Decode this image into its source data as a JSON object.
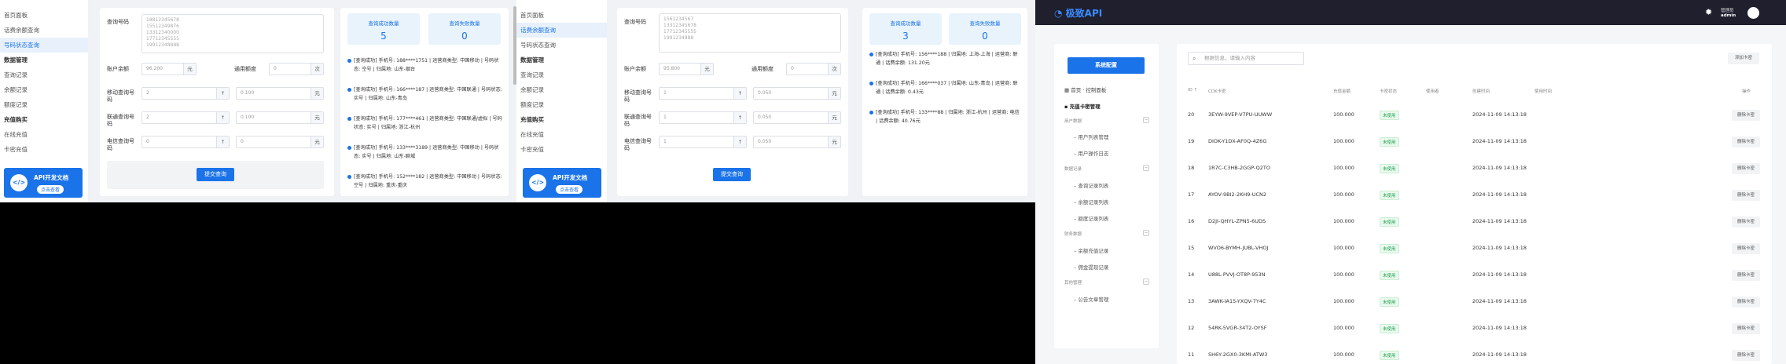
{
  "sidebar_a": {
    "items": [
      "首页面板",
      "话费余额查询",
      "号码状态查询"
    ],
    "sections": [
      {
        "title": "数据管理",
        "items": [
          "查询记录",
          "余额记录",
          "额度记录"
        ]
      },
      {
        "title": "充值购买",
        "items": [
          "在线充值",
          "卡密充值"
        ]
      }
    ]
  },
  "api_card": {
    "title": "API开发文档",
    "button": "点击查看",
    "icon": "</>"
  },
  "form": {
    "query_label": "查询号码",
    "query_text_a": "18812345678\n15512349876\n13312340000\n17712345555\n19912348888",
    "query_text_b": "1561234567\n13312345678\n17712345555\n1991234888",
    "balance_label": "账户余额",
    "balance_value": "96.200",
    "balance_unit": "元",
    "balance_value_b": "95.800",
    "limit_label": "通用额度",
    "limit_value": "0",
    "limit_unit": "次",
    "mobile_label": "移动查询号码",
    "mobile_count": "2",
    "mobile_price": "0.100",
    "mobile_count_b": "1",
    "mobile_price_b": "0.050",
    "unicom_label": "联通查询号码",
    "unicom_count": "2",
    "unicom_price": "0.100",
    "unicom_count_b": "1",
    "unicom_price_b": "0.050",
    "telecom_label": "电信查询号码",
    "telecom_count": "0",
    "telecom_price": "0",
    "telecom_count_b": "1",
    "telecom_price_b": "0.050",
    "stepper": "↑",
    "submit": "提交查询"
  },
  "results_a": {
    "success_label": "查询成功数量",
    "success_value": "5",
    "fail_label": "查询失败数量",
    "fail_value": "0",
    "logs": [
      "[查询成功] 手机号: 188****1751 | 运营商类型: 中国移动 | 号码状态: 空号 | 归属地: 山东-烟台",
      "[查询成功] 手机号: 166****187 | 运营商类型: 中国联通 | 号码状态: 实号 | 归属地: 山东-青岛",
      "[查询成功] 手机号: 177****461 | 运营商类型: 中国联通/虚拟 | 号码状态: 实号 | 归属地: 浙江-杭州",
      "[查询成功] 手机号: 133****3189 | 运营商类型: 中国移动 | 号码状态: 实号 | 归属地: 山东-聊城",
      "[查询成功] 手机号: 152****182 | 运营商类型: 中国移动 | 号码状态: 空号 | 归属地: 重庆-重庆"
    ]
  },
  "sidebar_b": {
    "items": [
      "首页面板",
      "话费余额查询",
      "号码状态查询"
    ],
    "sections": [
      {
        "title": "数据管理",
        "items": [
          "查询记录",
          "余额记录",
          "额度记录"
        ]
      },
      {
        "title": "充值购买",
        "items": [
          "在线充值",
          "卡密充值"
        ]
      }
    ]
  },
  "results_b": {
    "success_label": "查询成功数量",
    "success_value": "3",
    "fail_label": "查询失败数量",
    "fail_value": "0",
    "logs": [
      "[查询成功] 手机号: 156****188 | 归属地: 上海-上海 | 运营商: 联通 | 话费余额: 131.20元",
      "[查询成功] 手机号: 166****037 | 归属地: 山东-青岛 | 运营商: 联通 | 话费余额: 0.43元",
      "[查询成功] 手机号: 133****88 | 归属地: 浙江-杭州 | 运营商: 电信 | 话费余额: 40.76元"
    ]
  },
  "admin": {
    "logo": "极致API",
    "user_label": "管理员",
    "user_name": "admin",
    "sys_button": "系统配置",
    "menu_top": [
      "首页 · 控制面板",
      "充值卡密管理"
    ],
    "menu_sections": [
      {
        "title": "用户数据",
        "items": [
          "用户列表管理",
          "用户操作日志"
        ]
      },
      {
        "title": "数据记录",
        "items": [
          "查询记录列表",
          "余额记录列表",
          "额度记录列表"
        ]
      },
      {
        "title": "财务数据",
        "items": [
          "余额充值记录",
          "佣金提现记录"
        ]
      },
      {
        "title": "其他管理",
        "items": [
          "公告文章管理"
        ]
      }
    ],
    "search_placeholder": "根据信息，请输入内容",
    "add_button": "添加卡密",
    "columns": [
      "ID ↑",
      "CDK卡密",
      "充值金额",
      "卡密状态",
      "使用者",
      "创建时间",
      "使用时间",
      "操作"
    ],
    "status_tag": "未使用",
    "delete_label": "删除卡密",
    "rows": [
      {
        "id": "20",
        "cdk": "3EYW-9VEP-V7PU-UUWW",
        "amount": "100.000",
        "created": "2024-11-09 14:13:18"
      },
      {
        "id": "19",
        "cdk": "DIOK-Y1DX-AF0Q-4Z6G",
        "amount": "100.000",
        "created": "2024-11-09 14:13:18"
      },
      {
        "id": "18",
        "cdk": "1R7C-C3HB-2GGP-Q2TO",
        "amount": "100.000",
        "created": "2024-11-09 14:13:18"
      },
      {
        "id": "17",
        "cdk": "AYOV-9BI2-2KH9-UCN2",
        "amount": "100.000",
        "created": "2024-11-09 14:13:18"
      },
      {
        "id": "16",
        "cdk": "D2JI-QHYL-ZPN5-6UDS",
        "amount": "100.000",
        "created": "2024-11-09 14:13:18"
      },
      {
        "id": "15",
        "cdk": "WVO6-BYMH-JUBL-VHOJ",
        "amount": "100.000",
        "created": "2024-11-09 14:13:18"
      },
      {
        "id": "14",
        "cdk": "U88L-PVVJ-OT8P-953N",
        "amount": "100.000",
        "created": "2024-11-09 14:13:18"
      },
      {
        "id": "13",
        "cdk": "3AWK-IA15-YXQV-7Y4C",
        "amount": "100.000",
        "created": "2024-11-09 14:13:18"
      },
      {
        "id": "12",
        "cdk": "54RK-5VGR-34T2-OYSF",
        "amount": "100.000",
        "created": "2024-11-09 14:13:18"
      },
      {
        "id": "11",
        "cdk": "SH6Y-2GX0-3KMI-ATW3",
        "amount": "100.000",
        "created": "2024-11-09 14:13:18"
      }
    ]
  }
}
